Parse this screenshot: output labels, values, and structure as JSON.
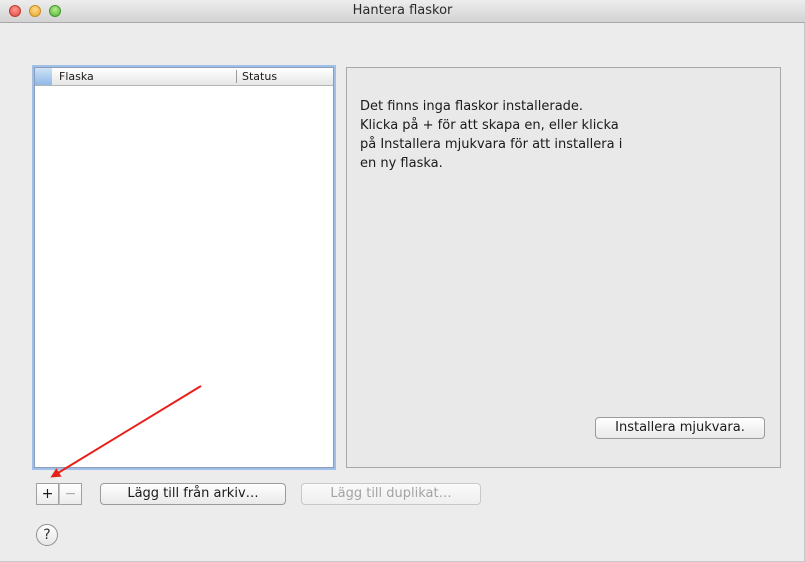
{
  "window": {
    "title": "Hantera flaskor"
  },
  "list": {
    "columns": [
      "Flaska",
      "Status"
    ]
  },
  "info": {
    "message_lines": [
      "Det finns inga flaskor installerade.",
      "Klicka på + för att skapa en, eller klicka",
      "på Installera mjukvara för att installera i",
      "en ny flaska."
    ],
    "install_label": "Installera mjukvara."
  },
  "toolbar": {
    "add_symbol": "+",
    "remove_symbol": "−",
    "archive_label": "Lägg till från arkiv…",
    "duplicate_label": "Lägg till duplikat…"
  },
  "help": {
    "symbol": "?"
  },
  "colors": {
    "annotation_arrow": "#e8201a",
    "accent": "#9fc0e8"
  }
}
